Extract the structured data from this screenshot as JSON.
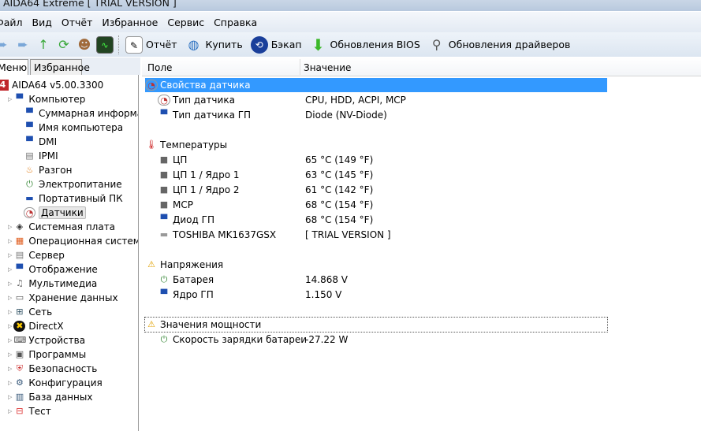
{
  "window": {
    "title": "AIDA64 Extreme  [ TRIAL VERSION ]"
  },
  "menu": [
    "Файл",
    "Вид",
    "Отчёт",
    "Избранное",
    "Сервис",
    "Справка"
  ],
  "toolbar": {
    "report": "Отчёт",
    "buy": "Купить",
    "backup": "Бэкап",
    "bios": "Обновления BIOS",
    "drivers": "Обновления драйверов"
  },
  "tabs": {
    "menu": "Меню",
    "favorites": "Избранное"
  },
  "tree": [
    {
      "label": "AIDA64 v5.00.3300",
      "level": 0,
      "icon": "aida-icon"
    },
    {
      "label": "Компьютер",
      "level": 1,
      "icon": "computer-icon"
    },
    {
      "label": "Суммарная информа",
      "level": 2,
      "icon": "computer-icon"
    },
    {
      "label": "Имя компьютера",
      "level": 2,
      "icon": "computer-icon"
    },
    {
      "label": "DMI",
      "level": 2,
      "icon": "computer-icon"
    },
    {
      "label": "IPMI",
      "level": 2,
      "icon": "server-icon"
    },
    {
      "label": "Разгон",
      "level": 2,
      "icon": "flame-icon"
    },
    {
      "label": "Электропитание",
      "level": 2,
      "icon": "power-icon"
    },
    {
      "label": "Портативный ПК",
      "level": 2,
      "icon": "laptop-icon"
    },
    {
      "label": "Датчики",
      "level": 2,
      "icon": "gauge-icon",
      "selected": true
    },
    {
      "label": "Системная плата",
      "level": 1,
      "icon": "motherboard-icon"
    },
    {
      "label": "Операционная система",
      "level": 1,
      "icon": "windows-icon"
    },
    {
      "label": "Сервер",
      "level": 1,
      "icon": "server-icon"
    },
    {
      "label": "Отображение",
      "level": 1,
      "icon": "monitor-icon"
    },
    {
      "label": "Мультимедиа",
      "level": 1,
      "icon": "multimedia-icon"
    },
    {
      "label": "Хранение данных",
      "level": 1,
      "icon": "storage-icon"
    },
    {
      "label": "Сеть",
      "level": 1,
      "icon": "network-icon"
    },
    {
      "label": "DirectX",
      "level": 1,
      "icon": "directx-icon"
    },
    {
      "label": "Устройства",
      "level": 1,
      "icon": "devices-icon"
    },
    {
      "label": "Программы",
      "level": 1,
      "icon": "programs-icon"
    },
    {
      "label": "Безопасность",
      "level": 1,
      "icon": "shield-icon"
    },
    {
      "label": "Конфигурация",
      "level": 1,
      "icon": "config-icon"
    },
    {
      "label": "База данных",
      "level": 1,
      "icon": "database-icon"
    },
    {
      "label": "Тест",
      "level": 1,
      "icon": "test-icon"
    }
  ],
  "table": {
    "col_field": "Поле",
    "col_value": "Значение",
    "rows": [
      {
        "field": "Свойства датчика",
        "value": "",
        "type": "group",
        "icon": "gauge-icon",
        "selected": true
      },
      {
        "field": "Тип датчика",
        "value": "CPU, HDD, ACPI, MCP",
        "icon": "gauge-icon"
      },
      {
        "field": "Тип датчика ГП",
        "value": "Diode  (NV-Diode)",
        "icon": "gpu-icon"
      },
      null,
      {
        "field": "Температуры",
        "value": "",
        "type": "group",
        "icon": "thermometer-icon"
      },
      {
        "field": "ЦП",
        "value": "65 °C  (149 °F)",
        "icon": "chip-icon"
      },
      {
        "field": "ЦП 1 / Ядро 1",
        "value": "63 °C  (145 °F)",
        "icon": "chip-icon"
      },
      {
        "field": "ЦП 1 / Ядро 2",
        "value": "61 °C  (142 °F)",
        "icon": "chip-icon"
      },
      {
        "field": "MCP",
        "value": "68 °C  (154 °F)",
        "icon": "chip-icon"
      },
      {
        "field": "Диод ГП",
        "value": "68 °C  (154 °F)",
        "icon": "gpu-icon"
      },
      {
        "field": "TOSHIBA MK1637GSX",
        "value": "[ TRIAL VERSION ]",
        "icon": "hdd-icon"
      },
      null,
      {
        "field": "Напряжения",
        "value": "",
        "type": "group",
        "icon": "warning-icon"
      },
      {
        "field": "Батарея",
        "value": "14.868 V",
        "icon": "battery-icon"
      },
      {
        "field": "Ядро ГП",
        "value": "1.150 V",
        "icon": "gpu-icon"
      },
      null,
      {
        "field": "Значения мощности",
        "value": "",
        "type": "group",
        "icon": "warning-icon",
        "focused": true
      },
      {
        "field": "Скорость зарядки батареи",
        "value": "-27.22 W",
        "icon": "power-icon"
      }
    ]
  },
  "colors": {
    "selection": "#3399ff"
  }
}
